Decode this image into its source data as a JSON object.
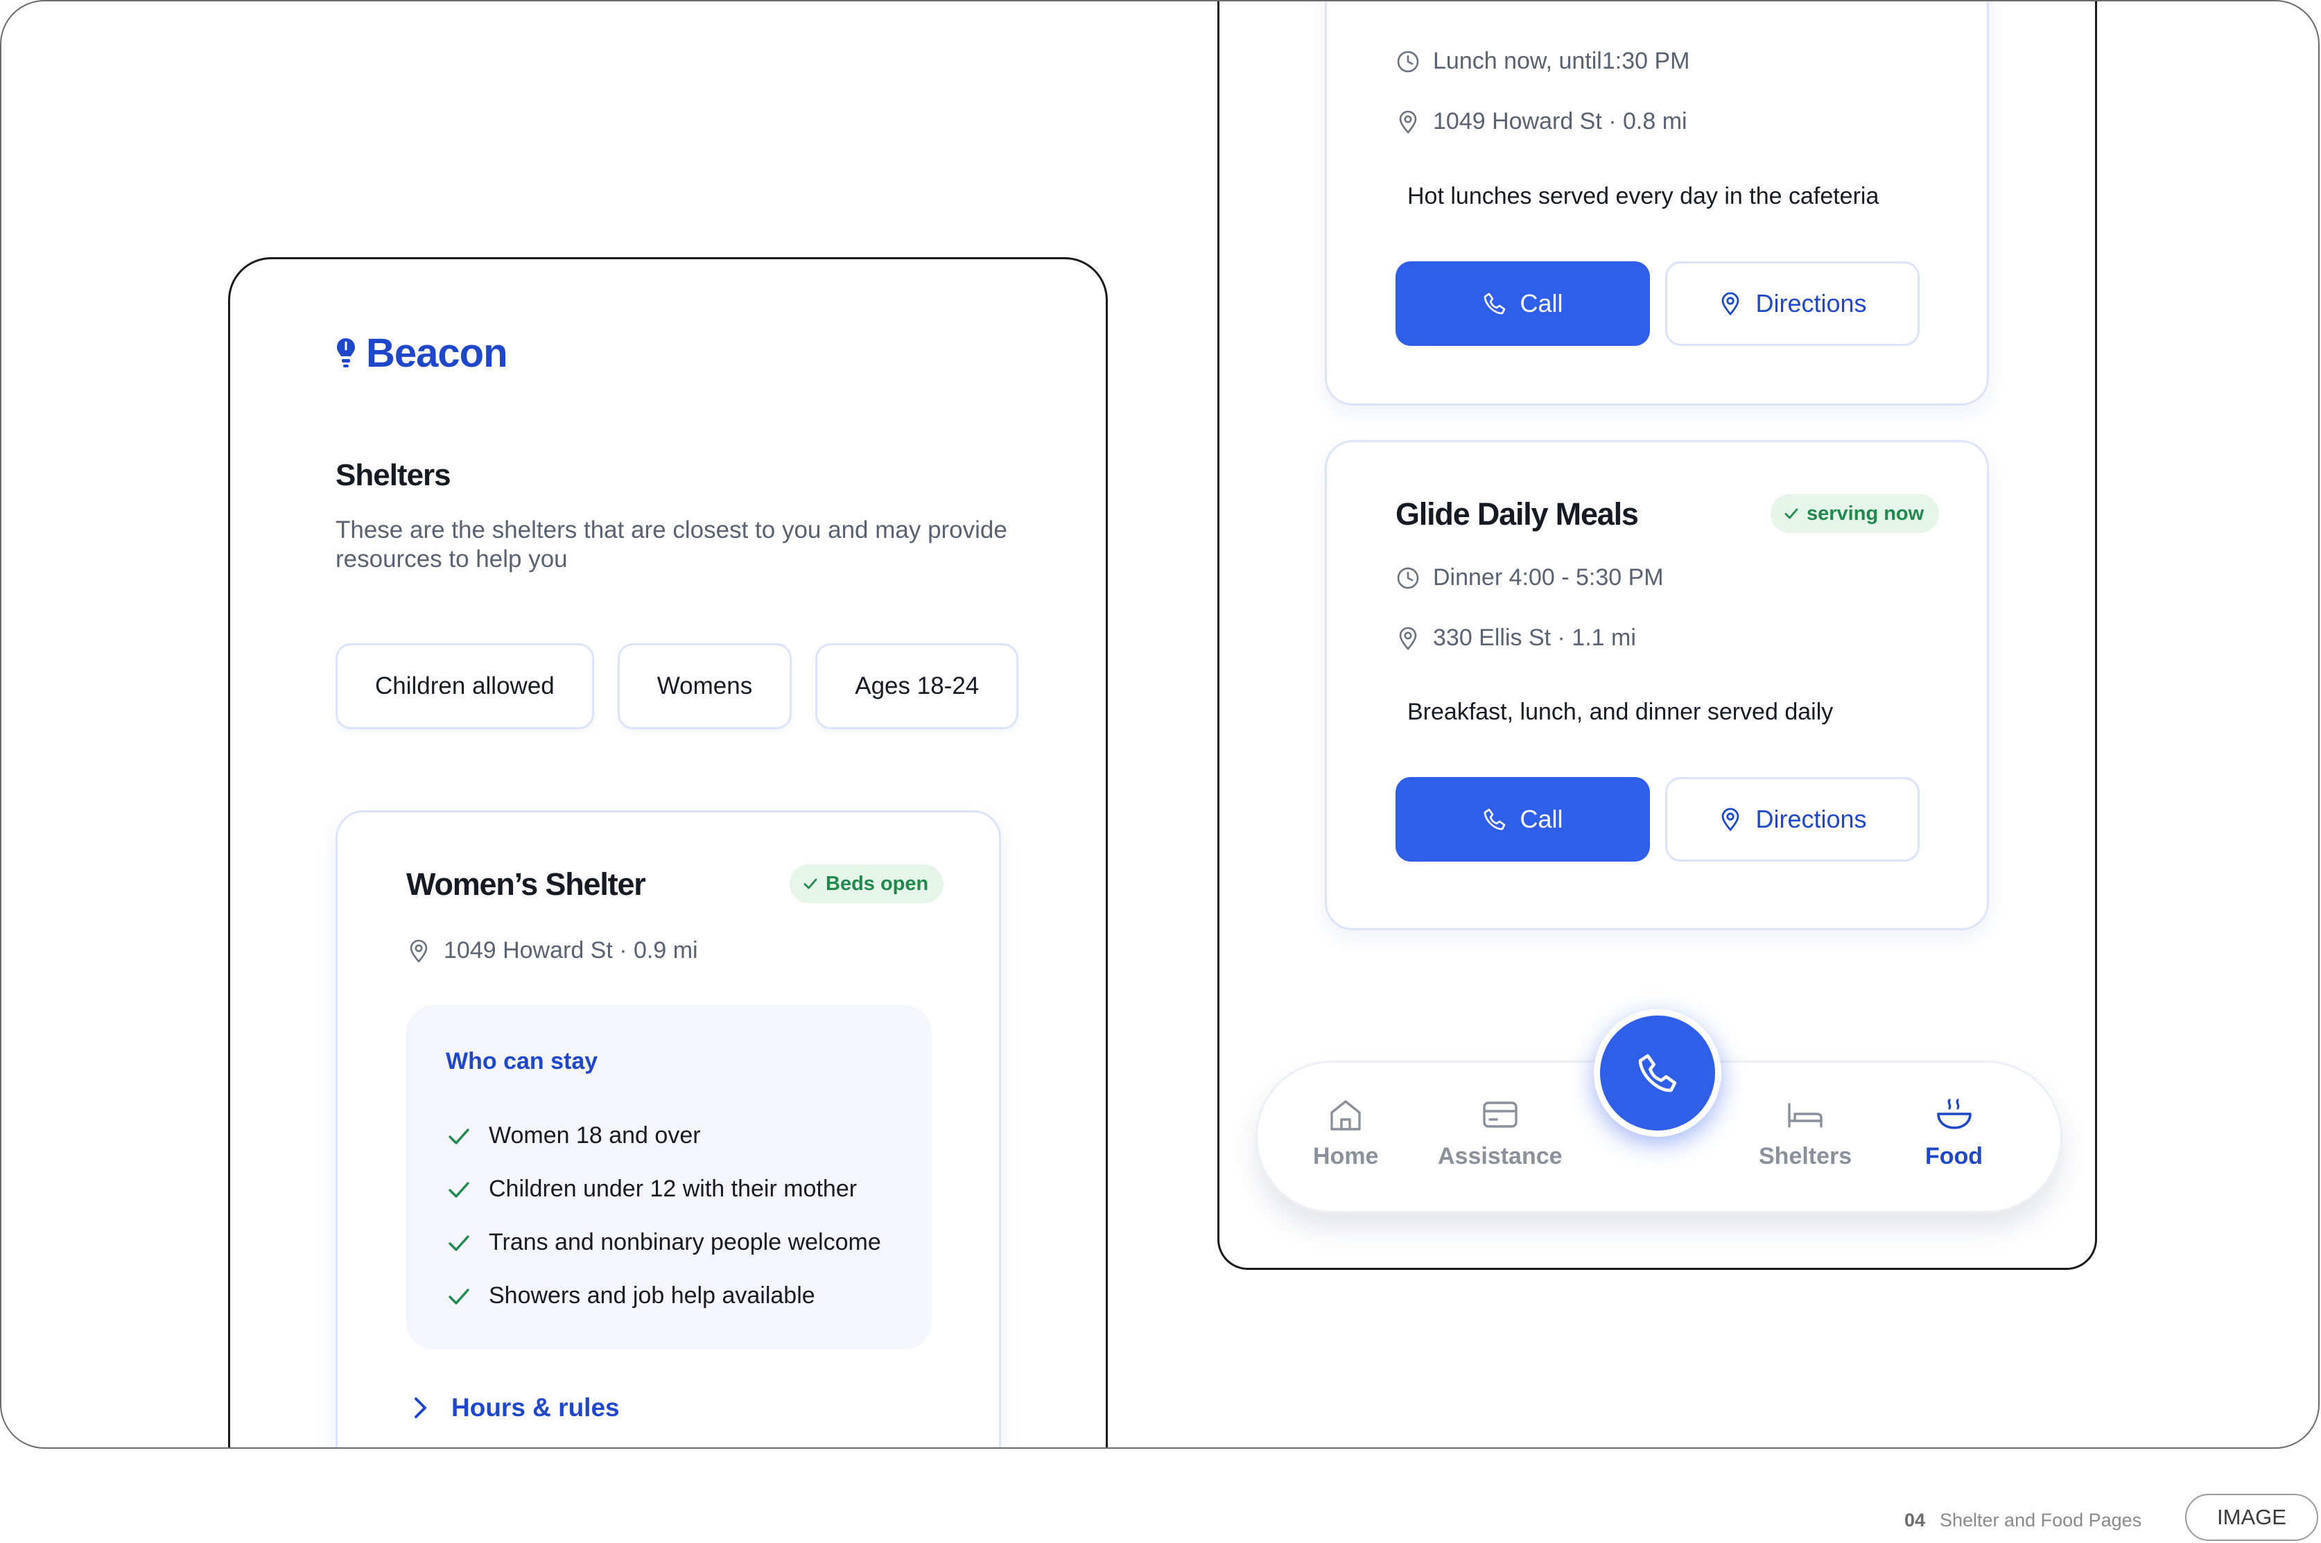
{
  "left_screen": {
    "brand": "Beacon",
    "section_title": "Shelters",
    "section_description": "These are the shelters that are closest to you and may provide resources to help you",
    "filters": [
      "Children allowed",
      "Womens",
      "Ages 18-24"
    ],
    "shelter_card": {
      "title": "Women’s Shelter",
      "badge": "Beds open",
      "address": "1049 Howard St · 0.9 mi",
      "who_can_stay_title": "Who can stay",
      "who_can_stay": [
        "Women 18 and over",
        "Children under 12 with their mother",
        "Trans and nonbinary people welcome",
        "Showers and job help available"
      ],
      "hours_link": "Hours & rules"
    }
  },
  "right_screen": {
    "food_cards": [
      {
        "hours": "Lunch now, until1:30 PM",
        "address": "1049 Howard St · 0.8 mi",
        "description": "Hot lunches served every day in the cafeteria",
        "call_label": "Call",
        "directions_label": "Directions"
      },
      {
        "title": "Glide Daily Meals",
        "badge": "serving now",
        "hours": "Dinner 4:00 - 5:30 PM",
        "address": "330 Ellis St · 1.1 mi",
        "description": "Breakfast, lunch, and dinner served daily",
        "call_label": "Call",
        "directions_label": "Directions"
      }
    ],
    "nav": {
      "items": [
        {
          "label": "Home",
          "icon": "home-icon"
        },
        {
          "label": "Assistance",
          "icon": "card-icon"
        },
        {
          "label": "Shelters",
          "icon": "bed-icon"
        },
        {
          "label": "Food",
          "icon": "bowl-icon"
        }
      ],
      "active": "Food",
      "fab_icon": "phone-icon"
    }
  },
  "footer": {
    "number": "04",
    "caption": "Shelter and Food Pages",
    "pill": "IMAGE"
  },
  "colors": {
    "primary": "#2f5ee8",
    "primary_text": "#1f47c9",
    "success": "#1f8a4c",
    "success_bg": "#e6f5ea"
  }
}
